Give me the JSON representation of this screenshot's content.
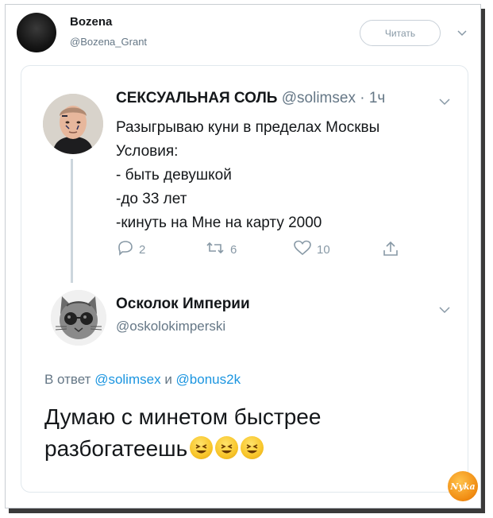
{
  "tweet": {
    "author_name": "Bozena",
    "author_handle": "@Bozena_Grant",
    "follow_label": "Читать"
  },
  "quoted": {
    "name": "СЕКСУАЛЬНАЯ СОЛЬ",
    "handle_time": "@solimsex · 1ч",
    "text": "Разыгрываю куни в пределах Москвы\nУсловия:\n- быть девушкой\n-до 33 лет\n-кинуть на Мне на карту 2000",
    "replies": "2",
    "retweets": "6",
    "likes": "10"
  },
  "reply": {
    "name": "Осколок Империи",
    "handle": "@oskolokimperski",
    "reply_prefix": "В ответ",
    "reply_user1": "@solimsex",
    "reply_and": "и",
    "reply_user2": "@bonus2k",
    "text_line1": "Думаю с минетом быстрее",
    "text_line2": "разбогатеешь"
  },
  "watermark": "Nyka",
  "colors": {
    "link": "#1b95e0",
    "secondary": "#657786",
    "icon": "#8899a6"
  }
}
